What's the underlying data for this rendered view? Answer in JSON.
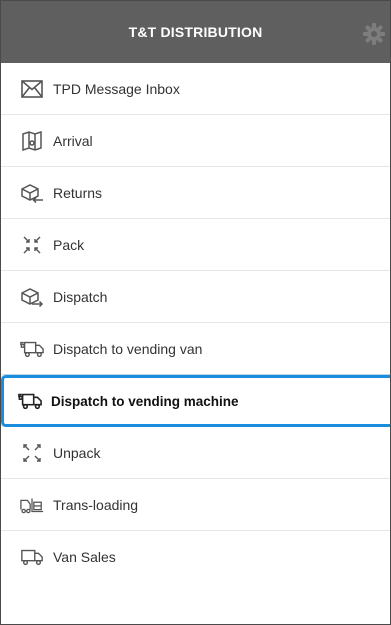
{
  "header": {
    "title": "T&T DISTRIBUTION"
  },
  "menu": {
    "items": [
      {
        "label": "TPD Message Inbox"
      },
      {
        "label": "Arrival"
      },
      {
        "label": "Returns"
      },
      {
        "label": "Pack"
      },
      {
        "label": "Dispatch"
      },
      {
        "label": "Dispatch to vending van"
      },
      {
        "label": "Dispatch to vending machine",
        "selected": true
      },
      {
        "label": "Unpack"
      },
      {
        "label": "Trans-loading"
      },
      {
        "label": "Van Sales"
      }
    ]
  },
  "colors": {
    "header_bg": "#5f5f5f",
    "selection_border": "#1b8ddf",
    "icon": "#555555"
  }
}
